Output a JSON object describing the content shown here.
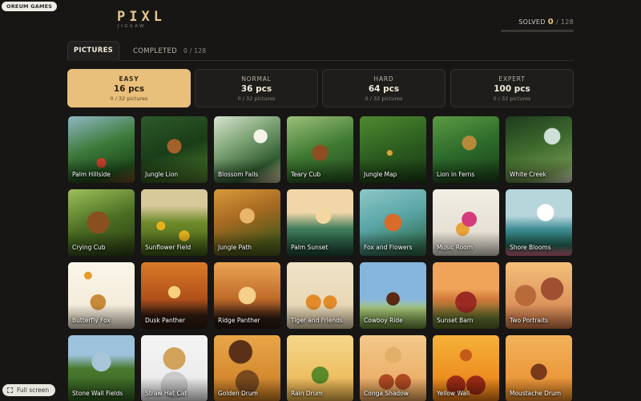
{
  "brand_badge": "OREUM GAMES",
  "logo": {
    "main": "PIXL",
    "sub": "JIGSAW"
  },
  "solved": {
    "label": "SOLVED",
    "count": "0",
    "total": "/ 128",
    "progress_fraction": 0
  },
  "tabs": {
    "pictures": "PICTURES",
    "completed": "COMPLETED",
    "completed_count": "0 / 128"
  },
  "levels": [
    {
      "name": "EASY",
      "pieces": "16 pcs",
      "progress": "0 / 32 pictures"
    },
    {
      "name": "NORMAL",
      "pieces": "36 pcs",
      "progress": "0 / 32 pictures"
    },
    {
      "name": "HARD",
      "pieces": "64 pcs",
      "progress": "0 / 32 pictures"
    },
    {
      "name": "EXPERT",
      "pieces": "100 pcs",
      "progress": "0 / 32 pictures"
    }
  ],
  "pictures": [
    "Palm Hillside",
    "Jungle Lion",
    "Blossom Falls",
    "Teary Cub",
    "Jungle Map",
    "Lion in Ferns",
    "White Creek",
    "Crying Cub",
    "Sunflower Field",
    "Jungle Path",
    "Palm Sunset",
    "Fox and Flowers",
    "Music Room",
    "Shore Blooms",
    "Butterfly Fox",
    "Dusk Panther",
    "Ridge Panther",
    "Tiger and Friends",
    "Cowboy Ride",
    "Sunset Barn",
    "Two Portraits",
    "Stone Wall Fields",
    "Straw Hat Cat",
    "Golden Drum",
    "Rain Drum",
    "Conga Shadow",
    "Yellow Wall",
    "Moustache Drum"
  ],
  "fullscreen_label": "Full screen",
  "colors": {
    "accent": "#e8bf7b",
    "background": "#171615"
  }
}
